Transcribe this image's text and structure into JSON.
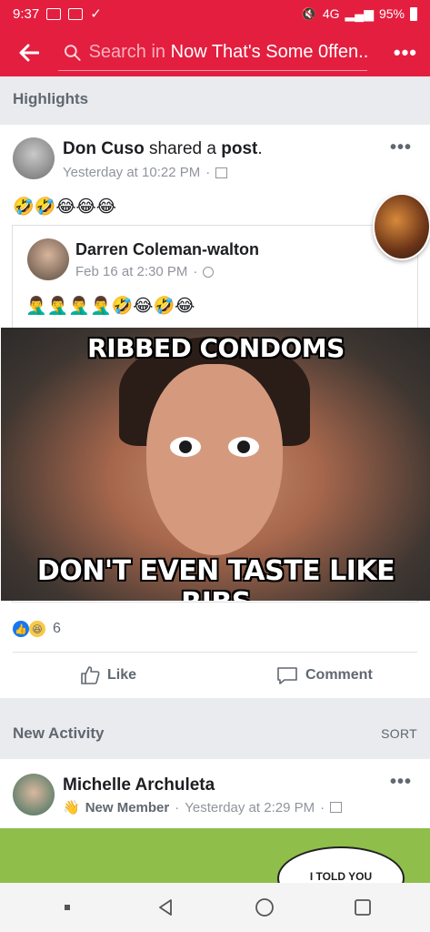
{
  "status_bar": {
    "time": "9:37",
    "network": "4G",
    "battery": "95%"
  },
  "header": {
    "search_prefix": "Search in",
    "search_group": "Now That's Some 0ffen..."
  },
  "highlights": {
    "title": "Highlights",
    "post": {
      "author": "Don Cuso",
      "action": "shared a",
      "object": "post",
      "time": "Yesterday at 10:22 PM",
      "emojis": "🤣🤣😂😂😂",
      "shared": {
        "author": "Darren Coleman-walton",
        "time": "Feb 16 at 2:30 PM",
        "emojis": "🤦‍♂️🤦‍♂️🤦‍♂️🤦‍♂️🤣😂🤣😂",
        "meme_top": "RIBBED CONDOMS",
        "meme_bottom": "DON'T EVEN TASTE LIKE RIBS"
      },
      "reaction_count": "6",
      "like_label": "Like",
      "comment_label": "Comment"
    }
  },
  "new_activity": {
    "title": "New Activity",
    "sort_label": "SORT",
    "item": {
      "author": "Michelle Archuleta",
      "badge": "New Member",
      "time": "Yesterday at 2:29 PM",
      "comic_text": "I TOLD YOU"
    }
  }
}
